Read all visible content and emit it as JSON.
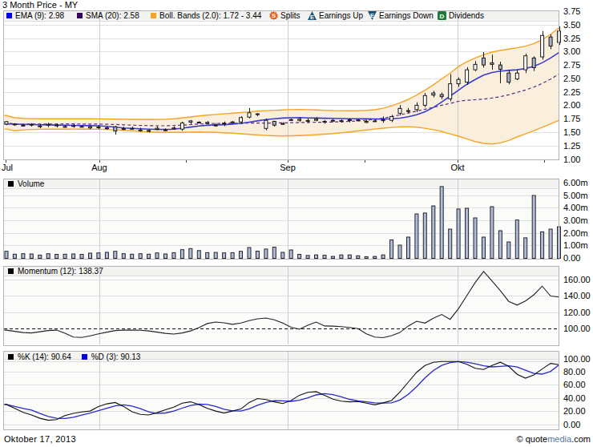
{
  "title": "3 Month Price - MY",
  "price_panel": {
    "legend": [
      {
        "swatch_color": "#0000ee",
        "label": "EMA (9): 2.98"
      },
      {
        "swatch_color": "#33005e",
        "label": "SMA (20): 2.58"
      },
      {
        "swatch_color": "#f5a623",
        "label": "Boll. Bands (2.0): 1.72 - 3.44"
      }
    ],
    "events": [
      {
        "icon": "splits-icon",
        "label": "Splits",
        "color": "#e8611c"
      },
      {
        "icon": "earnings-up-icon",
        "label": "Earnings Up",
        "color": "#17507d"
      },
      {
        "icon": "earnings-down-icon",
        "label": "Earnings Down",
        "color": "#17507d"
      },
      {
        "icon": "dividends-icon",
        "label": "Dividends",
        "color": "#1d7a3a"
      }
    ],
    "y_ticks": [
      "3.75",
      "3.50",
      "3.25",
      "3.00",
      "2.75",
      "2.50",
      "2.25",
      "2.00",
      "1.75",
      "1.50",
      "1.25",
      "1.00"
    ]
  },
  "volume_panel": {
    "label": "Volume",
    "y_ticks": [
      "6.00m",
      "5.00m",
      "4.00m",
      "3.00m",
      "2.00m",
      "1.00m",
      "0.00"
    ]
  },
  "momentum_panel": {
    "label": "Momentum (12): 138.37",
    "y_ticks": [
      "160.00",
      "140.00",
      "120.00",
      "100.00"
    ]
  },
  "stochastics_panel": {
    "k_label": "%K (14): 90.64",
    "d_label": "%D (3): 90.13",
    "k_swatch_color": "#000000",
    "d_swatch_color": "#0000e0",
    "y_ticks": [
      "100.00",
      "80.00",
      "60.00",
      "40.00",
      "20.00",
      "0.00"
    ]
  },
  "x_axis": {
    "months": [
      {
        "label": "Jul",
        "index": 0,
        "edge": true
      },
      {
        "label": "Aug",
        "index": 11.1
      },
      {
        "label": "Sep",
        "index": 33.6
      },
      {
        "label": "Okt",
        "index": 53.9
      }
    ],
    "minor_tick_indices": [
      21.4,
      42.8,
      64.2
    ]
  },
  "footer": {
    "date": "Oktober 17, 2013",
    "credit_copy": "© ",
    "credit_quote": "quote",
    "credit_media": "media",
    "credit_com": ".com",
    "media_color": "#5c7899"
  },
  "colors": {
    "band_fill": "#faeedd",
    "band_line": "#f5a426",
    "ema_line": "#3b3bd1",
    "sma_line": "#5b2f7d",
    "candle_stroke": "#1a1a1a",
    "candle_down_fill": "#a7b0c8",
    "candle_up_fill": "#ffffff",
    "volume_fill": "#b1bdd8",
    "volume_stroke": "#23242c",
    "momentum_line": "#222222",
    "k_line": "#111111",
    "d_line": "#2929cc"
  },
  "chart_data": [
    {
      "type": "candlestick",
      "name": "3 Month Price - MY",
      "ylim": [
        1.0,
        3.75
      ],
      "y_tick_step": 0.25,
      "open": [
        1.65,
        1.652,
        1.628,
        1.643,
        1.604,
        1.646,
        1.632,
        1.605,
        1.621,
        1.606,
        1.577,
        1.594,
        1.58,
        1.6,
        1.567,
        1.562,
        1.536,
        1.517,
        1.573,
        1.542,
        1.578,
        1.555,
        1.688,
        1.686,
        1.681,
        1.617,
        1.668,
        1.673,
        1.69,
        1.78,
        1.832,
        1.57,
        1.7,
        1.655,
        1.733,
        1.721,
        1.717,
        1.742,
        1.688,
        1.709,
        1.714,
        1.732,
        1.727,
        1.68,
        1.71,
        1.714,
        1.72,
        1.85,
        1.9,
        1.92,
        2.0,
        2.23,
        2.2,
        2.12,
        2.4,
        2.43,
        2.66,
        2.88,
        2.79,
        2.75,
        2.6,
        2.49,
        2.66,
        2.88,
        2.9,
        3.27,
        3.17
      ],
      "high": [
        1.708,
        1.666,
        1.651,
        1.667,
        1.655,
        1.674,
        1.661,
        1.634,
        1.65,
        1.635,
        1.623,
        1.633,
        1.616,
        1.618,
        1.601,
        1.602,
        1.581,
        1.556,
        1.613,
        1.569,
        1.606,
        1.697,
        1.725,
        1.701,
        1.705,
        1.668,
        1.697,
        1.706,
        1.798,
        1.95,
        1.852,
        1.751,
        1.713,
        1.684,
        1.751,
        1.774,
        1.751,
        1.778,
        1.726,
        1.745,
        1.739,
        1.757,
        1.742,
        1.727,
        1.737,
        1.793,
        1.821,
        2.004,
        1.949,
        2.054,
        2.229,
        2.268,
        2.239,
        2.58,
        2.517,
        2.709,
        2.821,
        2.99,
        2.94,
        2.811,
        2.66,
        2.66,
        2.962,
        2.913,
        3.38,
        3.321,
        3.47
      ],
      "low": [
        1.63,
        1.615,
        1.604,
        1.604,
        1.573,
        1.591,
        1.587,
        1.589,
        1.583,
        1.591,
        1.556,
        1.556,
        1.544,
        1.455,
        1.536,
        1.544,
        1.509,
        1.492,
        1.533,
        1.519,
        1.544,
        1.524,
        1.652,
        1.662,
        1.643,
        1.602,
        1.613,
        1.659,
        1.654,
        1.756,
        1.797,
        1.533,
        1.603,
        1.638,
        1.706,
        1.688,
        1.67,
        1.704,
        1.656,
        1.686,
        1.677,
        1.683,
        1.706,
        1.666,
        1.691,
        1.675,
        1.686,
        1.813,
        1.852,
        1.873,
        1.966,
        2.147,
        2.113,
        2.073,
        2.341,
        2.378,
        2.635,
        2.702,
        2.66,
        2.41,
        2.39,
        2.468,
        2.6,
        2.637,
        2.85,
        3.044,
        3.12
      ],
      "close": [
        1.695,
        1.64,
        1.625,
        1.645,
        1.615,
        1.63,
        1.62,
        1.605,
        1.62,
        1.605,
        1.6,
        1.59,
        1.575,
        1.52,
        1.55,
        1.57,
        1.54,
        1.53,
        1.55,
        1.532,
        1.56,
        1.67,
        1.71,
        1.68,
        1.66,
        1.63,
        1.655,
        1.69,
        1.77,
        1.86,
        1.84,
        1.72,
        1.63,
        1.66,
        1.73,
        1.74,
        1.71,
        1.72,
        1.7,
        1.72,
        1.7,
        1.715,
        1.72,
        1.7,
        1.71,
        1.73,
        1.79,
        1.94,
        1.89,
        2.0,
        2.18,
        2.19,
        2.16,
        2.4,
        2.48,
        2.66,
        2.76,
        2.75,
        2.76,
        2.67,
        2.43,
        2.6,
        2.92,
        2.7,
        3.3,
        3.1,
        3.38
      ],
      "overlays": {
        "ema9": [
          1.652,
          1.648,
          1.645,
          1.641,
          1.638,
          1.635,
          1.632,
          1.629,
          1.626,
          1.623,
          1.62,
          1.618,
          1.607,
          1.592,
          1.578,
          1.57,
          1.562,
          1.556,
          1.552,
          1.55,
          1.556,
          1.574,
          1.595,
          1.615,
          1.628,
          1.635,
          1.64,
          1.65,
          1.664,
          1.686,
          1.71,
          1.733,
          1.75,
          1.762,
          1.768,
          1.77,
          1.765,
          1.761,
          1.758,
          1.755,
          1.752,
          1.75,
          1.748,
          1.747,
          1.745,
          1.744,
          1.748,
          1.76,
          1.785,
          1.825,
          1.88,
          1.96,
          2.06,
          2.17,
          2.28,
          2.39,
          2.48,
          2.56,
          2.61,
          2.635,
          2.648,
          2.66,
          2.685,
          2.725,
          2.79,
          2.88,
          2.98
        ],
        "sma20": [
          1.684,
          1.647,
          1.648,
          1.651,
          1.651,
          1.652,
          1.652,
          1.653,
          1.653,
          1.652,
          1.652,
          1.65,
          1.647,
          1.643,
          1.637,
          1.631,
          1.625,
          1.621,
          1.618,
          1.619,
          1.623,
          1.631,
          1.641,
          1.651,
          1.657,
          1.662,
          1.664,
          1.666,
          1.667,
          1.668,
          1.668,
          1.669,
          1.67,
          1.672,
          1.675,
          1.679,
          1.681,
          1.683,
          1.685,
          1.688,
          1.694,
          1.701,
          1.711,
          1.723,
          1.737,
          1.76,
          1.789,
          1.821,
          1.855,
          1.891,
          1.926,
          1.962,
          2.0,
          2.034,
          2.073,
          2.093,
          2.103,
          2.115,
          2.135,
          2.16,
          2.195,
          2.24,
          2.284,
          2.339,
          2.405,
          2.487,
          2.58
        ],
        "boll_upper": [
          1.81,
          1.768,
          1.755,
          1.751,
          1.75,
          1.75,
          1.75,
          1.75,
          1.749,
          1.748,
          1.748,
          1.747,
          1.745,
          1.743,
          1.74,
          1.738,
          1.736,
          1.735,
          1.736,
          1.74,
          1.75,
          1.765,
          1.782,
          1.8,
          1.815,
          1.828,
          1.84,
          1.852,
          1.865,
          1.878,
          1.89,
          1.9,
          1.908,
          1.914,
          1.918,
          1.92,
          1.918,
          1.914,
          1.908,
          1.902,
          1.9,
          1.898,
          1.9,
          1.906,
          1.916,
          1.945,
          1.99,
          2.045,
          2.11,
          2.19,
          2.28,
          2.38,
          2.49,
          2.6,
          2.72,
          2.81,
          2.88,
          2.94,
          2.99,
          3.02,
          3.045,
          3.07,
          3.1,
          3.15,
          3.22,
          3.32,
          3.44
        ],
        "boll_lower": [
          1.558,
          1.525,
          1.542,
          1.55,
          1.553,
          1.554,
          1.555,
          1.556,
          1.557,
          1.556,
          1.556,
          1.553,
          1.55,
          1.543,
          1.534,
          1.524,
          1.514,
          1.506,
          1.5,
          1.497,
          1.496,
          1.497,
          1.5,
          1.502,
          1.5,
          1.495,
          1.488,
          1.48,
          1.47,
          1.458,
          1.447,
          1.438,
          1.432,
          1.43,
          1.432,
          1.437,
          1.444,
          1.452,
          1.462,
          1.474,
          1.488,
          1.504,
          1.522,
          1.54,
          1.558,
          1.574,
          1.588,
          1.598,
          1.6,
          1.592,
          1.572,
          1.545,
          1.51,
          1.468,
          1.425,
          1.375,
          1.325,
          1.29,
          1.28,
          1.3,
          1.345,
          1.41,
          1.468,
          1.528,
          1.59,
          1.655,
          1.72
        ]
      }
    },
    {
      "type": "bar",
      "name": "Volume",
      "unit": "millions",
      "ylim": [
        0,
        6
      ],
      "values": [
        0.53,
        0.3,
        0.34,
        0.32,
        0.23,
        0.34,
        0.29,
        0.3,
        0.32,
        0.29,
        0.38,
        0.4,
        0.45,
        0.53,
        0.34,
        0.3,
        0.34,
        0.3,
        0.4,
        0.32,
        0.42,
        0.66,
        0.75,
        0.59,
        0.42,
        0.44,
        0.4,
        0.42,
        0.53,
        0.83,
        0.54,
        0.71,
        0.86,
        0.45,
        0.64,
        0.29,
        0.2,
        0.24,
        0.22,
        0.12,
        0.24,
        0.24,
        0.17,
        0.1,
        0.12,
        0.24,
        1.44,
        1.02,
        1.66,
        3.51,
        3.58,
        4.15,
        5.69,
        2.3,
        3.9,
        3.96,
        3.19,
        1.66,
        4.09,
        2.17,
        1.28,
        3.03,
        1.6,
        4.98,
        2.08,
        2.3,
        2.49
      ]
    },
    {
      "type": "line",
      "name": "Momentum (12)",
      "last_value": 138.37,
      "ylim_ticks": [
        100,
        120,
        140,
        160
      ],
      "baseline": 100,
      "values": [
        98,
        96.5,
        95,
        94.5,
        96,
        97.5,
        98,
        94,
        89.5,
        89,
        91,
        93.5,
        95.5,
        97.5,
        98,
        98,
        97.8,
        97,
        95.5,
        94,
        93.2,
        94.5,
        97,
        101,
        106,
        107.8,
        106.8,
        105,
        106.5,
        109.5,
        111.7,
        112.7,
        110.5,
        106.5,
        101.5,
        99,
        104,
        107.8,
        103,
        102.8,
        102.2,
        101.2,
        99.8,
        93.5,
        89.5,
        88.8,
        91.2,
        95,
        103,
        108.8,
        106.5,
        112.5,
        117,
        111,
        124,
        140,
        156,
        169.5,
        158,
        146,
        133,
        128.5,
        133.5,
        141,
        151.5,
        139.5,
        138.37
      ]
    },
    {
      "type": "line",
      "name": "Stochastics",
      "ylim": [
        0,
        100
      ],
      "series": [
        {
          "name": "%K (14)",
          "last_value": 90.64,
          "values": [
            30,
            24,
            18,
            14,
            9,
            6,
            7,
            13,
            16.5,
            18.5,
            20,
            27,
            31,
            33,
            27,
            19,
            15,
            14,
            17.5,
            22,
            26,
            32,
            34,
            30,
            24,
            20,
            17,
            20,
            23,
            33,
            39,
            37.5,
            34,
            31.5,
            36,
            44,
            48.5,
            49.5,
            44,
            38,
            35,
            34,
            34.4,
            32,
            29.4,
            32.5,
            36,
            49,
            64,
            79,
            89.4,
            94.3,
            95.5,
            95.5,
            95.5,
            91.2,
            85,
            83.2,
            89.4,
            94.3,
            88,
            76,
            70,
            75,
            84,
            92.5,
            90.64
          ]
        },
        {
          "name": "%D (3)",
          "last_value": 90.13,
          "values": [
            30.0,
            27.0,
            24.0,
            21.5,
            16.25,
            11.75,
            9.0,
            8.75,
            10.62,
            13.75,
            17.0,
            20.5,
            24.12,
            27.75,
            29.5,
            27.5,
            23.5,
            18.75,
            16.38,
            17.12,
            19.88,
            24.38,
            28.5,
            30.5,
            30.0,
            27.0,
            22.75,
            20.25,
            20.0,
            23.25,
            28.75,
            33.12,
            35.88,
            35.5,
            34.75,
            36.38,
            40.0,
            44.5,
            46.5,
            45.0,
            41.62,
            37.75,
            35.35,
            33.85,
            32.45,
            32.08,
            32.48,
            36.73,
            45.38,
            57.0,
            70.35,
            81.67,
            89.55,
            93.67,
            95.2,
            94.42,
            91.8,
            88.72,
            87.2,
            87.97,
            88.72,
            86.92,
            82.08,
            77.25,
            76.25,
            80.38,
            90.13
          ]
        }
      ]
    }
  ]
}
